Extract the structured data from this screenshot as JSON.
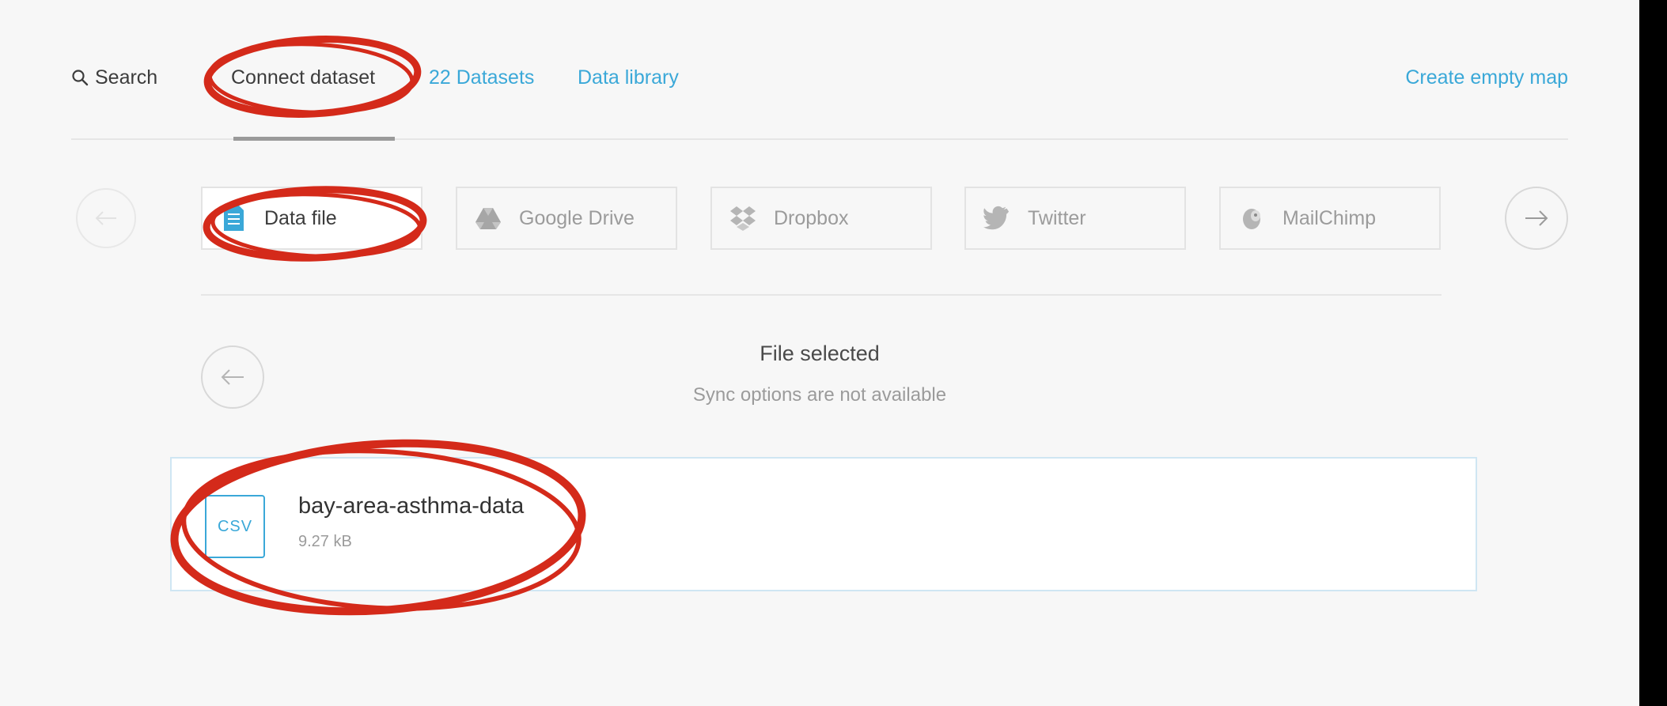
{
  "nav": {
    "search_label": "Search",
    "connect_label": "Connect dataset",
    "datasets_label": "22 Datasets",
    "library_label": "Data library",
    "create_map_label": "Create empty map"
  },
  "sources": {
    "items": [
      {
        "label": "Data file",
        "icon": "document-icon"
      },
      {
        "label": "Google Drive",
        "icon": "google-drive-icon"
      },
      {
        "label": "Dropbox",
        "icon": "dropbox-icon"
      },
      {
        "label": "Twitter",
        "icon": "twitter-icon"
      },
      {
        "label": "MailChimp",
        "icon": "mailchimp-icon"
      }
    ]
  },
  "status": {
    "title": "File selected",
    "subtitle": "Sync options are not available"
  },
  "file": {
    "type": "CSV",
    "name": "bay-area-asthma-data",
    "size": "9.27 kB"
  },
  "colors": {
    "link": "#3aa8d8",
    "annotation": "#d42a1a",
    "background": "#f7f7f7"
  }
}
